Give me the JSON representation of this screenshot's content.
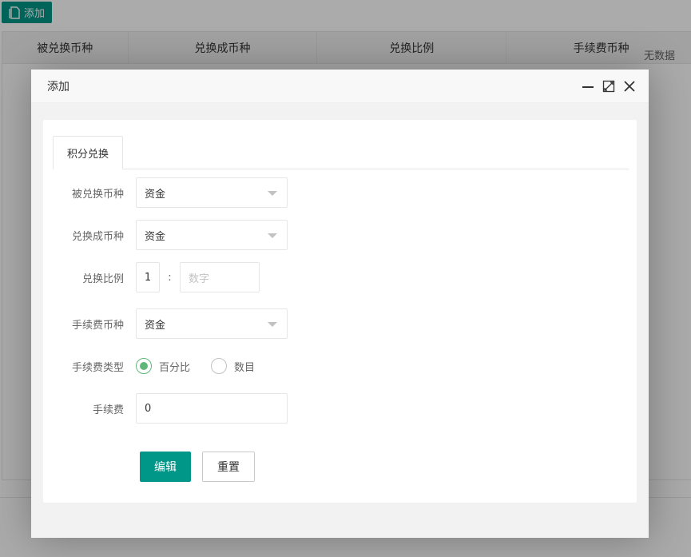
{
  "toolbar": {
    "add_label": "添加"
  },
  "table": {
    "columns": [
      "被兑换币种",
      "兑换成币种",
      "兑换比例",
      "手续费币种"
    ],
    "empty_text": "无数据"
  },
  "modal": {
    "title": "添加",
    "tab": "积分兑换",
    "fields": {
      "from_currency": {
        "label": "被兑换币种",
        "value": "资金"
      },
      "to_currency": {
        "label": "兑换成币种",
        "value": "资金"
      },
      "ratio": {
        "label": "兑换比例",
        "left_value": "1",
        "separator": ":",
        "right_placeholder": "数字"
      },
      "fee_currency": {
        "label": "手续费币种",
        "value": "资金"
      },
      "fee_type": {
        "label": "手续费类型",
        "options": [
          "百分比",
          "数目"
        ],
        "selected": "百分比"
      },
      "fee": {
        "label": "手续费",
        "value": "0"
      }
    },
    "buttons": {
      "submit": "编辑",
      "reset": "重置"
    }
  },
  "colors": {
    "primary": "#009688",
    "radio_checked": "#5fb878"
  }
}
